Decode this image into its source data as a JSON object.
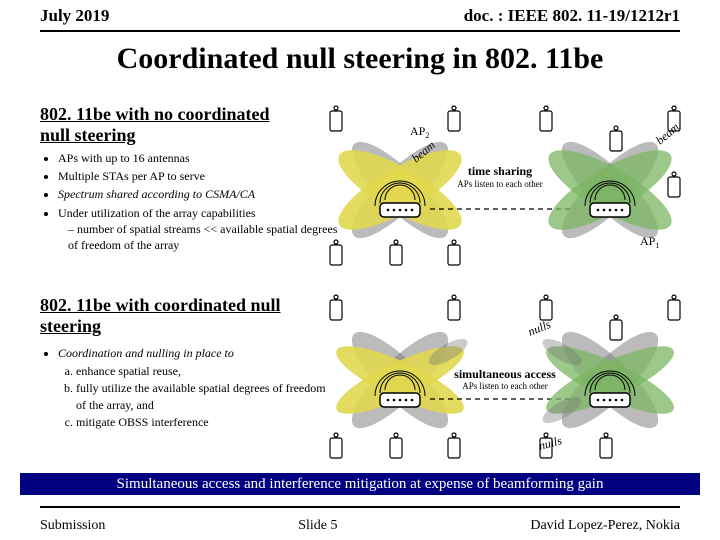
{
  "header": {
    "date": "July 2019",
    "doc": "doc. : IEEE 802. 11-19/1212r1"
  },
  "title": "Coordinated null steering in 802. 11be",
  "section1": {
    "label": "802. 11be with no coordinated null steering",
    "bullets": {
      "b1": "APs with up to 16 antennas",
      "b2": "Multiple STAs per AP to serve",
      "b3": "Spectrum shared according to CSMA/CA",
      "b4": "Under utilization of the array capabilities",
      "b4a": "– number of spatial streams << available spatial degrees of freedom of the array"
    }
  },
  "section2": {
    "label": "802. 11be with coordinated null steering",
    "bullets": {
      "b1": "Coordination and nulling in place to",
      "b1a": "enhance spatial reuse,",
      "b1b": "fully utilize the available spatial degrees of freedom of the array, and",
      "b1c": "mitigate OBSS interference"
    }
  },
  "diagram": {
    "ap2": "AP",
    "ap2sub": "2",
    "ap1": "AP",
    "ap1sub": "1",
    "beam": "beam",
    "nulls": "nulls",
    "timesharing": "time sharing",
    "timenote": "APs listen to each other",
    "simul": "simultaneous access",
    "simulnote": "APs listen to each other"
  },
  "summary": "Simultaneous access and interference mitigation at expense of beamforming gain",
  "footer": {
    "left": "Submission",
    "center": "Slide 5",
    "right": "David Lopez-Perez, Nokia"
  }
}
